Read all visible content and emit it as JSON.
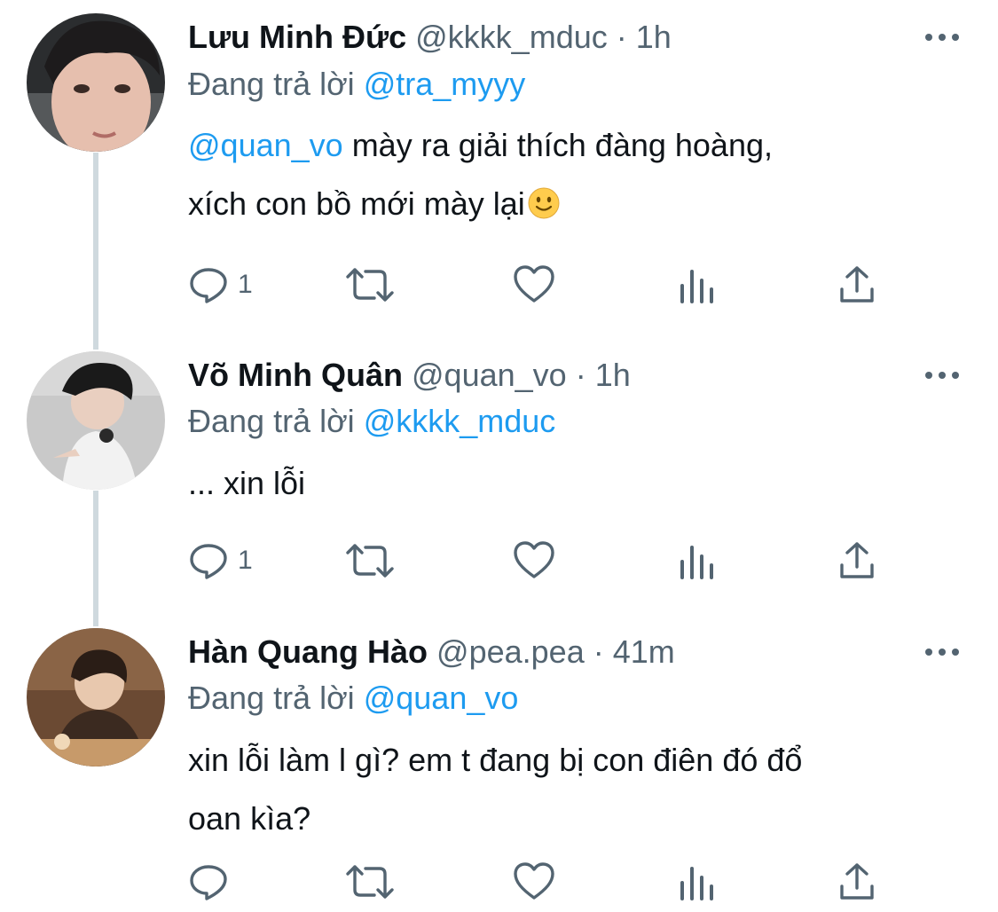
{
  "colors": {
    "accent": "#1d9bf0",
    "muted": "#536471",
    "text": "#0f1419",
    "thread_line": "#cfd9de"
  },
  "tweets": [
    {
      "display_name": "Lưu Minh Đức",
      "handle": "@kkkk_mduc",
      "separator": "·",
      "time": "1h",
      "reply_prefix": "Đang trả lời",
      "reply_to": "@tra_myyy",
      "mention": "@quan_vo",
      "text_line1": " mày ra giải thích đàng hoàng,",
      "text_line2": "xích con bồ mới mày lại",
      "emoji": "slightly-smiling-face-emoji",
      "reply_count": "1",
      "avatar": "avatar-photo"
    },
    {
      "display_name": "Võ Minh Quân",
      "handle": "@quan_vo",
      "separator": "·",
      "time": "1h",
      "reply_prefix": "Đang trả lời",
      "reply_to": "@kkkk_mduc",
      "text_line1": "... xin lỗi",
      "reply_count": "1",
      "avatar": "avatar-photo"
    },
    {
      "display_name": "Hàn Quang Hào",
      "handle": "@pea.pea",
      "separator": "·",
      "time": "41m",
      "reply_prefix": "Đang trả lời",
      "reply_to": "@quan_vo",
      "text_line1": "xin lỗi làm l gì? em t đang bị con điên đó đổ",
      "text_line2": "oan kìa?",
      "reply_count": "",
      "avatar": "avatar-photo"
    }
  ],
  "icons": [
    "more-icon",
    "reply-icon",
    "retweet-icon",
    "like-icon",
    "views-icon",
    "share-icon"
  ]
}
